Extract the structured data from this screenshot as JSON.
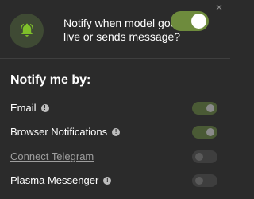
{
  "header": {
    "notify_text": "Notify when model goes live or sends message?",
    "master_toggle": true,
    "close_glyph": "×"
  },
  "section": {
    "title": "Notify me by:"
  },
  "options": [
    {
      "label": "Email",
      "info": true,
      "enabled": true
    },
    {
      "label": "Browser Notifications",
      "info": true,
      "enabled": true
    },
    {
      "label": "Connect Telegram",
      "info": false,
      "enabled": false,
      "is_link": true
    },
    {
      "label": "Plasma Messenger",
      "info": true,
      "enabled": false
    }
  ],
  "icons": {
    "bell": "bell-icon",
    "info": "info-icon",
    "close": "close-icon"
  },
  "colors": {
    "background": "#2b2b2b",
    "accent_green": "#6e8b3d",
    "bell_green": "#7fbf2a",
    "bell_circle": "#3f4a34",
    "toggle_on_small": "#4a5a35",
    "toggle_off_small": "#3e3e3e"
  }
}
